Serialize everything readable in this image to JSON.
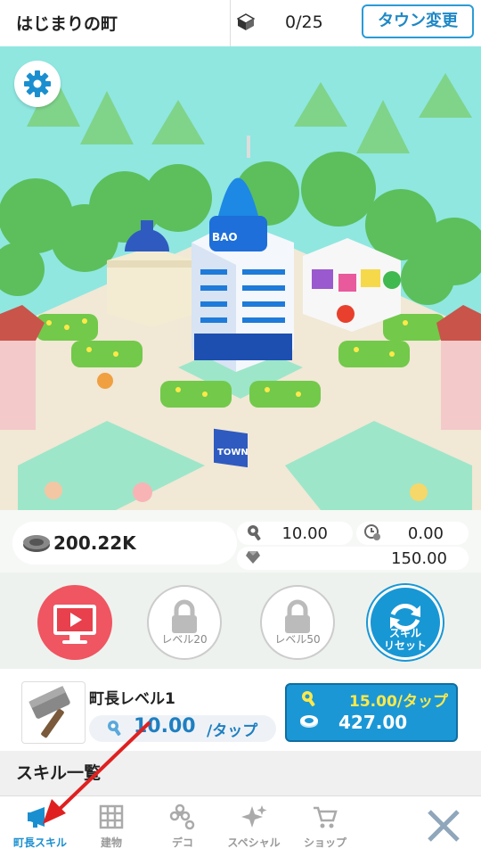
{
  "header": {
    "town_name": "はじまりの町",
    "progress": "0/25",
    "change_town_label": "タウン変更"
  },
  "scene": {
    "sign_text": "TOWN",
    "building_text": "BAO"
  },
  "stats": {
    "coins": "200.22K",
    "tap_value": "10.00",
    "auto_value": "0.00",
    "gems": "150.00"
  },
  "actions": {
    "lock20_label": "レベル20",
    "lock50_label": "レベル50",
    "reset_line1": "スキル",
    "reset_line2": "リセット"
  },
  "mayor": {
    "title": "町長レベル1",
    "tap_value": "10.00",
    "tap_unit": "/タップ",
    "upgrade_tap": "15.00/タップ",
    "upgrade_cost": "427.00"
  },
  "skills": {
    "title": "スキル一覧"
  },
  "nav": [
    {
      "label": "町長スキル",
      "icon": "megaphone-icon"
    },
    {
      "label": "建物",
      "icon": "building-icon"
    },
    {
      "label": "デコ",
      "icon": "flower-icon"
    },
    {
      "label": "スペシャル",
      "icon": "sparkle-icon"
    },
    {
      "label": "ショップ",
      "icon": "cart-icon"
    }
  ],
  "colors": {
    "accent": "#1a8fd0",
    "video": "#f05562",
    "annotation": "#e02020"
  }
}
